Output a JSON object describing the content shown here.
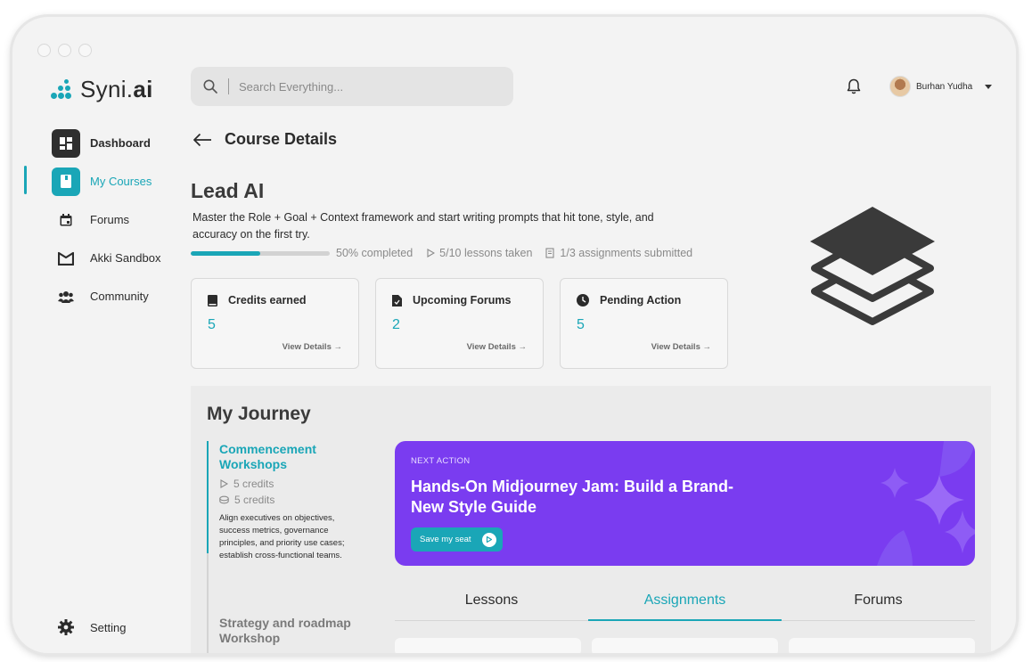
{
  "brand": {
    "name_light": "Syni.",
    "name_bold": "ai",
    "accent": "#1aa6b7",
    "purple": "#7a3cf0"
  },
  "sidebar": {
    "items": [
      {
        "label": "Dashboard",
        "icon": "dashboard-icon"
      },
      {
        "label": "My Courses",
        "icon": "book-icon",
        "active": true
      },
      {
        "label": "Forums",
        "icon": "calendar-icon"
      },
      {
        "label": "Akki Sandbox",
        "icon": "sandbox-icon"
      },
      {
        "label": "Community",
        "icon": "community-icon"
      }
    ],
    "setting": "Setting"
  },
  "search": {
    "placeholder": "Search Everything..."
  },
  "user": {
    "name": "Burhan Yudha"
  },
  "page": {
    "title": "Course Details"
  },
  "course": {
    "title": "Lead AI",
    "description": "Master the Role + Goal + Context framework and start writing prompts that hit tone, style, and accuracy on the first try.",
    "progress_percent": 50,
    "progress_text": "50% completed",
    "lessons_text": "5/10 lessons taken",
    "assignments_text": "1/3 assignments submitted"
  },
  "stats": [
    {
      "label": "Credits earned",
      "value": "5",
      "link": "View Details",
      "icon": "book-icon"
    },
    {
      "label": "Upcoming Forums",
      "value": "2",
      "link": "View Details",
      "icon": "document-icon"
    },
    {
      "label": "Pending Action",
      "value": "5",
      "link": "View Details",
      "icon": "clock-icon"
    }
  ],
  "journey": {
    "title": "My Journey",
    "step1": {
      "title": "Commencement Workshops",
      "meta1": "5 credits",
      "meta2": "5 credits",
      "desc": "Align executives on objectives, success metrics, governance principles, and priority use cases; establish cross-functional teams."
    },
    "step2": {
      "title": "Strategy and roadmap Workshop"
    },
    "next": {
      "label": "NEXT ACTION",
      "title": "Hands-On Midjourney Jam: Build a Brand-New Style Guide",
      "button": "Save my seat"
    },
    "tabs": [
      "Lessons",
      "Assignments",
      "Forums"
    ],
    "active_tab": "Assignments"
  }
}
